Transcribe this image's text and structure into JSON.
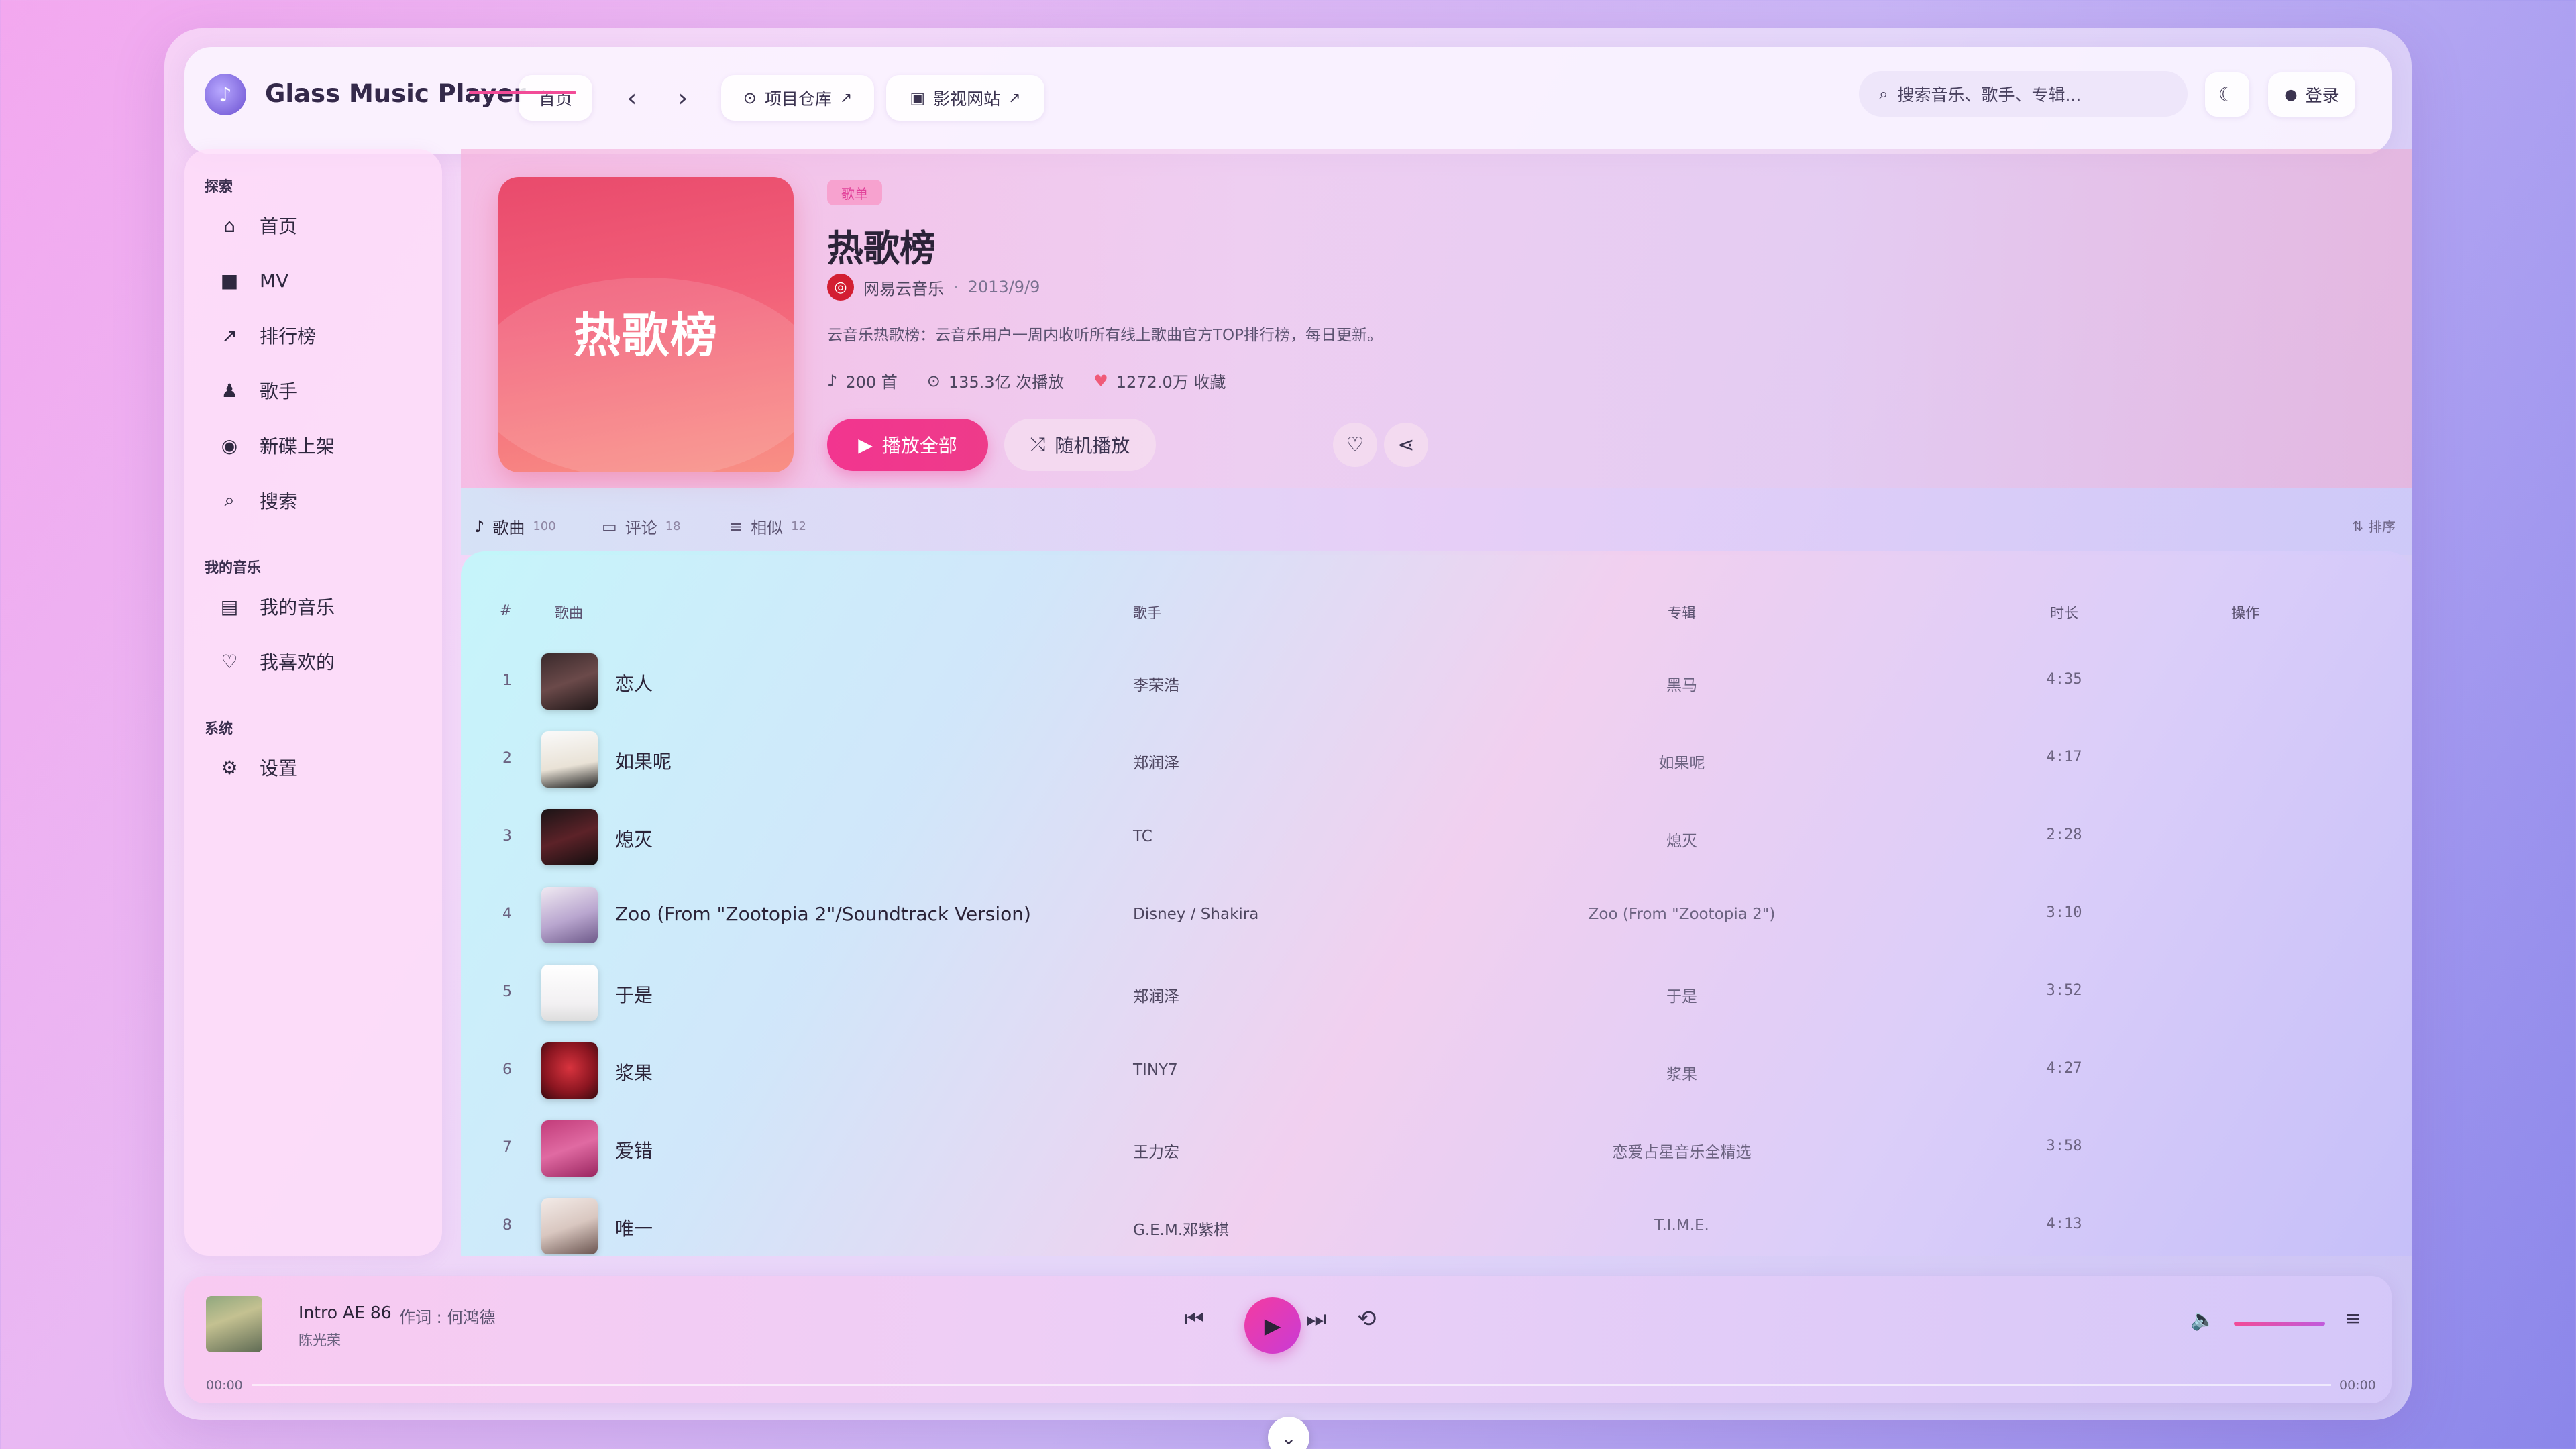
{
  "app": {
    "title": "Glass Music Player"
  },
  "topbar": {
    "home": "首页",
    "back_icon": "chevron-left-icon",
    "forward_icon": "chevron-right-icon",
    "repo_link": "项目仓库",
    "video_link": "影视网站",
    "search_placeholder": "搜索音乐、歌手、专辑...",
    "login": "登录"
  },
  "sidebar": {
    "explore_title": "探索",
    "explore": [
      {
        "label": "首页",
        "icon": "home-icon"
      },
      {
        "label": "MV",
        "icon": "video-icon"
      },
      {
        "label": "排行榜",
        "icon": "chart-icon"
      },
      {
        "label": "歌手",
        "icon": "singer-icon"
      },
      {
        "label": "新碟上架",
        "icon": "disc-icon"
      },
      {
        "label": "搜索",
        "icon": "search-icon"
      }
    ],
    "mine_title": "我的音乐",
    "mine": [
      {
        "label": "我的音乐",
        "icon": "library-icon"
      },
      {
        "label": "我喜欢的",
        "icon": "heart-icon"
      }
    ],
    "system_title": "系统",
    "system": [
      {
        "label": "设置",
        "icon": "gear-icon"
      }
    ]
  },
  "playlist": {
    "cover_text": "热歌榜",
    "tag": "歌单",
    "title": "热歌榜",
    "creator": "网易云音乐",
    "date": "2013/9/9",
    "description": "云音乐热歌榜：云音乐用户一周内收听所有线上歌曲官方TOP排行榜，每日更新。",
    "track_count": "200 首",
    "play_count": "135.3亿 次播放",
    "fav_count": "1272.0万 收藏",
    "play_all": "播放全部",
    "shuffle": "随机播放",
    "accent": "#f2358f"
  },
  "tabs": [
    {
      "label": "歌曲",
      "count": "100"
    },
    {
      "label": "评论",
      "count": "18"
    },
    {
      "label": "相似",
      "count": "12"
    }
  ],
  "sort_label": "排序",
  "table": {
    "headers": {
      "num": "#",
      "song": "歌曲",
      "artist": "歌手",
      "album": "专辑",
      "duration": "时长",
      "actions": "操作"
    },
    "rows": [
      {
        "num": "1",
        "name": "恋人",
        "artist": "李荣浩",
        "album": "黑马",
        "duration": "4:35"
      },
      {
        "num": "2",
        "name": "如果呢",
        "artist": "郑润泽",
        "album": "如果呢",
        "duration": "4:17"
      },
      {
        "num": "3",
        "name": "熄灭",
        "artist": "TC",
        "album": "熄灭",
        "duration": "2:28"
      },
      {
        "num": "4",
        "name": "Zoo (From \"Zootopia 2\"/Soundtrack Version)",
        "artist": "Disney / Shakira",
        "album": "Zoo (From \"Zootopia 2\")",
        "duration": "3:10"
      },
      {
        "num": "5",
        "name": "于是",
        "artist": "郑润泽",
        "album": "于是",
        "duration": "3:52"
      },
      {
        "num": "6",
        "name": "浆果",
        "artist": "TINY7",
        "album": "浆果",
        "duration": "4:27"
      },
      {
        "num": "7",
        "name": "爱错",
        "artist": "王力宏",
        "album": "恋爱占星音乐全精选",
        "duration": "3:58"
      },
      {
        "num": "8",
        "name": "唯一",
        "artist": "G.E.M.邓紫棋",
        "album": "T.I.M.E.",
        "duration": "4:13"
      }
    ]
  },
  "player": {
    "title": "Intro AE 86",
    "lyric": "作词 : 何鸿德",
    "artist": "陈光荣",
    "current_time": "00:00",
    "total_time": "00:00"
  }
}
